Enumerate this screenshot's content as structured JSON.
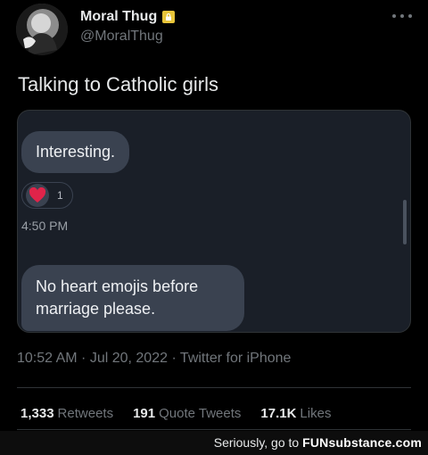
{
  "profile": {
    "display_name": "Moral Thug",
    "handle": "@MoralThug",
    "avatar_icon": "avatar-image",
    "badge_icon": "lock-badge-icon",
    "badge_color": "#e8c53a"
  },
  "tweet": {
    "text": "Talking to Catholic girls",
    "timestamp": "10:52 AM · Jul 20, 2022 · Twitter for iPhone"
  },
  "screenshot": {
    "message1": "Interesting.",
    "reaction_count": "1",
    "reaction_icon": "heart-icon",
    "reaction_color": "#e0244a",
    "message_time": "4:50 PM",
    "message2": "No heart emojis before marriage please."
  },
  "stats": [
    {
      "count": "1,333",
      "label": "Retweets"
    },
    {
      "count": "191",
      "label": "Quote Tweets"
    },
    {
      "count": "17.1K",
      "label": "Likes"
    }
  ],
  "watermark": {
    "text": "Seriously, go to",
    "brand": "FUNsubstance.com"
  },
  "colors": {
    "background": "#000000",
    "text": "#e7e9ea",
    "muted": "#71767b",
    "bubble": "#3a4250",
    "media_bg": "#1a1f28"
  }
}
